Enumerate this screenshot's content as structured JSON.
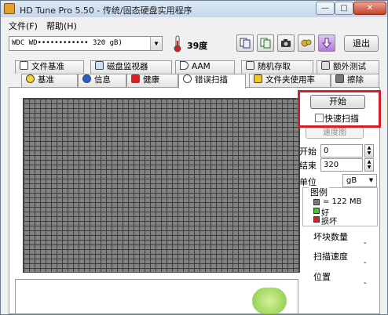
{
  "window": {
    "title": "HD Tune Pro 5.50 - 传统/固态硬盘实用程序",
    "controls": {
      "minimize": "—",
      "maximize": "□",
      "close": "✕"
    }
  },
  "menu": {
    "items": [
      "文件(F)",
      "帮助(H)"
    ]
  },
  "toolbar": {
    "drive_label": "WDC WD••••••••••••  320 gB)",
    "drive_arrow": "▼",
    "temperature": "39度",
    "buttons": [
      "copy-info-icon",
      "copy-screenshot-icon",
      "camera-icon",
      "settings-icon",
      "save-arrow-icon"
    ],
    "exit_label": "退出"
  },
  "tabs": {
    "row1": [
      "文件基准",
      "磁盘监视器",
      "AAM",
      "随机存取",
      "额外测试"
    ],
    "row2": [
      "基准",
      "信息",
      "健康",
      "错误扫描",
      "文件夹使用率",
      "擦除"
    ],
    "active": "错误扫描"
  },
  "scan": {
    "start_label": "开始",
    "quick_scan_label": "快速扫描",
    "quick_scan_checked": false,
    "disabled_button_label": "速度图",
    "start_field_label": "开始",
    "start_value": "0",
    "end_field_label": "结束",
    "end_value": "320",
    "unit_label": "单位",
    "unit_value": "gB",
    "legend_title": "图例",
    "legend": [
      {
        "text": "= 122 MB",
        "color": "#7a7a7a"
      },
      {
        "text": "好",
        "color": "#3cc43c"
      },
      {
        "text": "损坏",
        "color": "#e02020"
      }
    ],
    "stats": [
      {
        "label": "坏块数量",
        "value": "-"
      },
      {
        "label": "扫描速度",
        "value": "-"
      },
      {
        "label": "位置",
        "value": "-"
      }
    ]
  }
}
